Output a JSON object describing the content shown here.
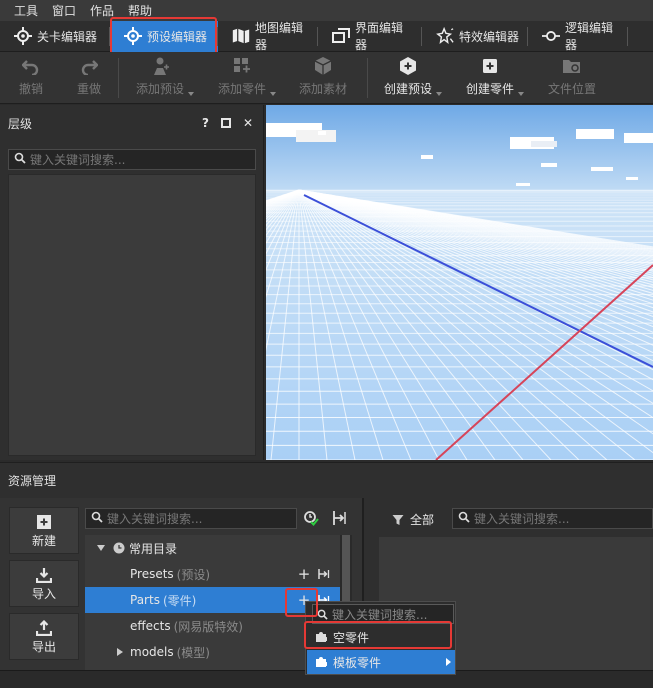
{
  "menu": {
    "items": [
      "工具",
      "窗口",
      "作品",
      "帮助"
    ]
  },
  "editors": {
    "tabs": [
      {
        "label": "关卡编辑器",
        "icon": "crosshair-icon"
      },
      {
        "label": "预设编辑器",
        "icon": "crosshair-icon",
        "active": true
      },
      {
        "label": "地图编辑器",
        "icon": "map-icon"
      },
      {
        "label": "界面编辑器",
        "icon": "window-icon"
      },
      {
        "label": "特效编辑器",
        "icon": "sparkle-icon"
      },
      {
        "label": "逻辑编辑器",
        "icon": "node-icon"
      }
    ]
  },
  "toolbar": {
    "undo": "撤销",
    "redo": "重做",
    "add_preset": "添加预设",
    "add_part": "添加零件",
    "add_asset": "添加素材",
    "create_preset": "创建预设",
    "create_part": "创建零件",
    "file_location": "文件位置"
  },
  "hierarchy": {
    "title": "层级",
    "search_placeholder": "键入关键词搜索...",
    "help": "?",
    "close": "✕"
  },
  "resources": {
    "title": "资源管理",
    "new": "新建",
    "import": "导入",
    "export": "导出",
    "search_placeholder": "键入关键词搜索...",
    "tree": {
      "root": "常用目录",
      "items": [
        {
          "name": "Presets",
          "sub": "(预设)"
        },
        {
          "name": "Parts",
          "sub": "(零件)",
          "selected": true
        },
        {
          "name": "effects",
          "sub": "(网易版特效)"
        },
        {
          "name": "models",
          "sub": "(模型)"
        }
      ]
    },
    "filter_label": "全部",
    "right_search_placeholder": "键入关键词搜索..."
  },
  "popup": {
    "search_placeholder": "键入关键词搜索...",
    "items": [
      {
        "label": "空零件"
      },
      {
        "label": "模板零件"
      }
    ]
  },
  "colors": {
    "accent": "#2e7ed3",
    "highlight": "#e53935",
    "sky": "#a9cff5"
  }
}
